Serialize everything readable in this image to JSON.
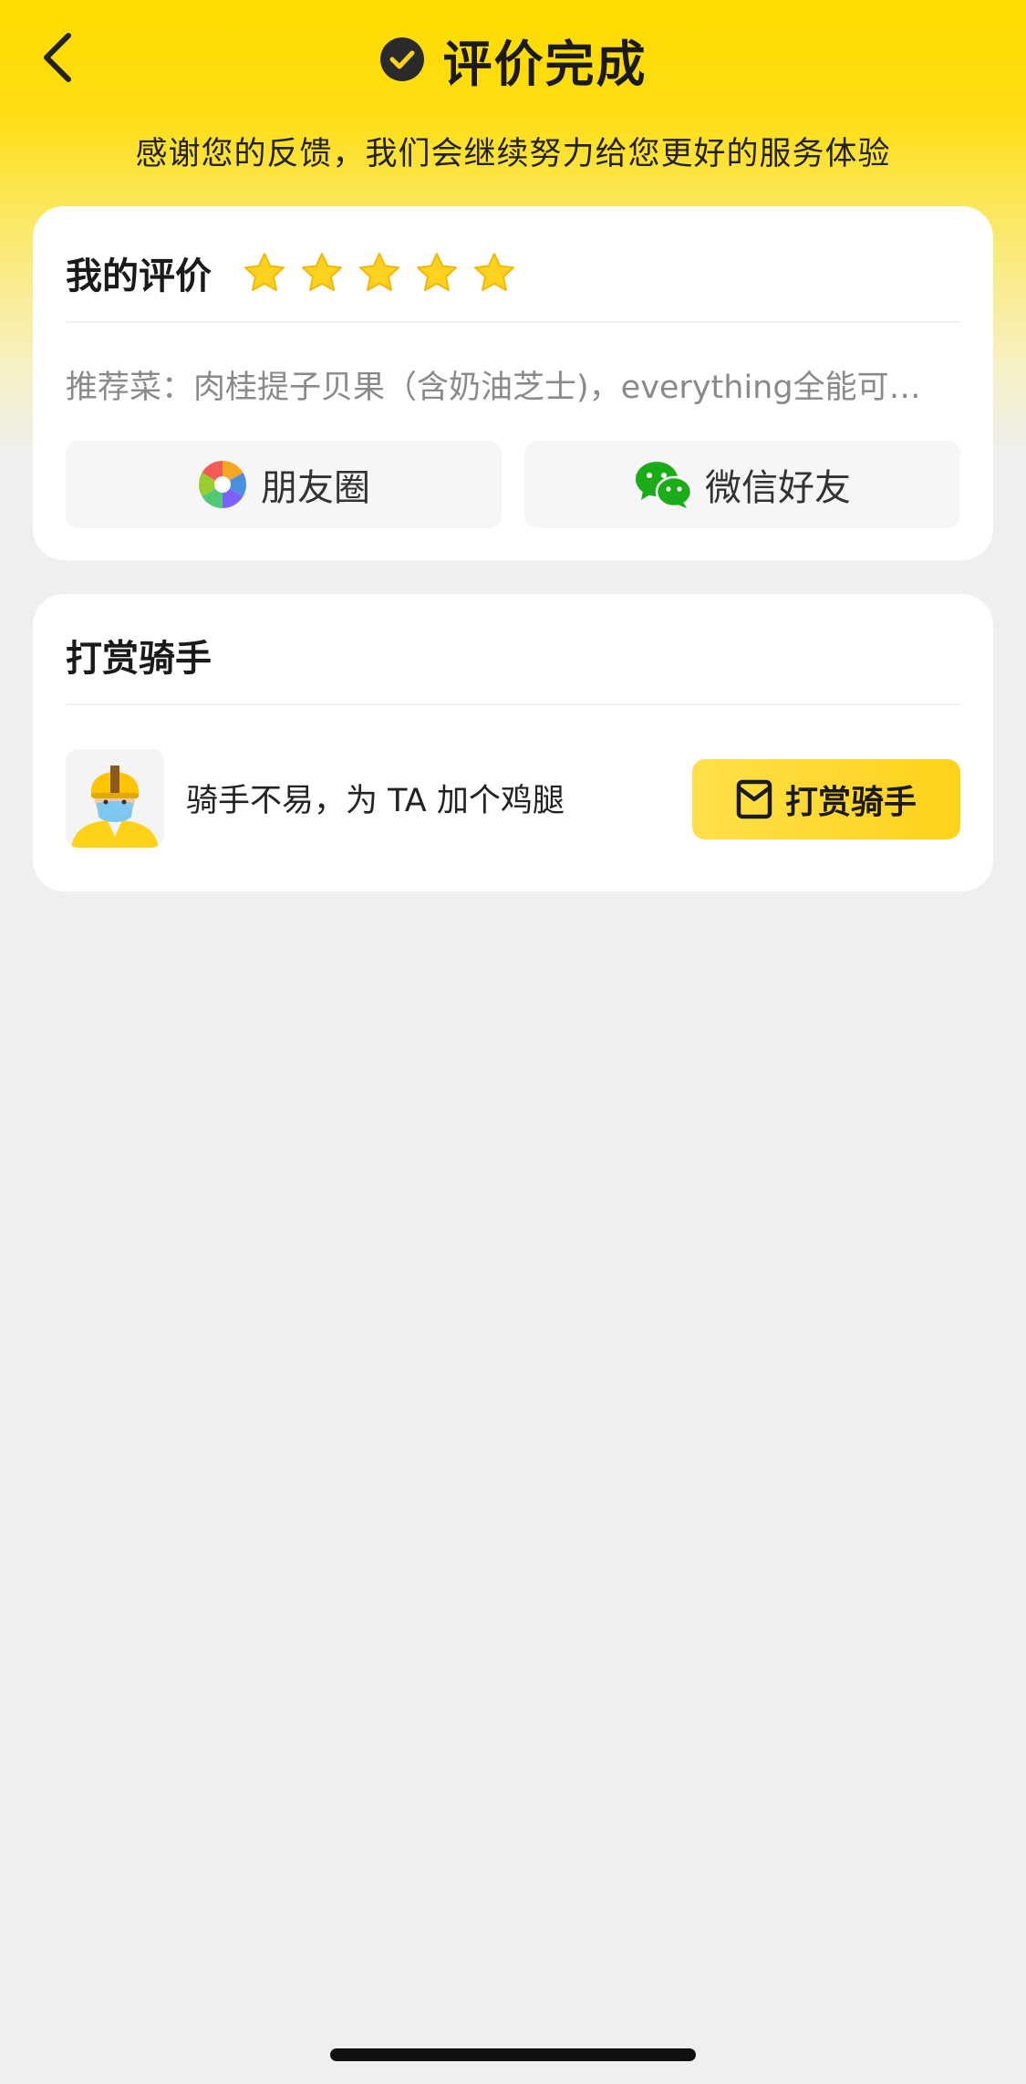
{
  "header": {
    "title": "评价完成",
    "subtitle": "感谢您的反馈，我们会继续努力给您更好的服务体验"
  },
  "review": {
    "section_title": "我的评价",
    "rating": 5,
    "rating_max": 5,
    "recommend_text": "推荐菜：肉桂提子贝果（含奶油芝士)，everything全能可…",
    "share_buttons": [
      {
        "label": "朋友圈",
        "icon": "moments-icon"
      },
      {
        "label": "微信好友",
        "icon": "wechat-icon"
      }
    ]
  },
  "tip": {
    "section_title": "打赏骑手",
    "rider_text": "骑手不易，为 TA 加个鸡腿",
    "button_label": "打赏骑手"
  },
  "colors": {
    "brand_yellow": "#ffdb00",
    "star_yellow": "#ffd21f",
    "wechat_green": "#1aad19"
  }
}
